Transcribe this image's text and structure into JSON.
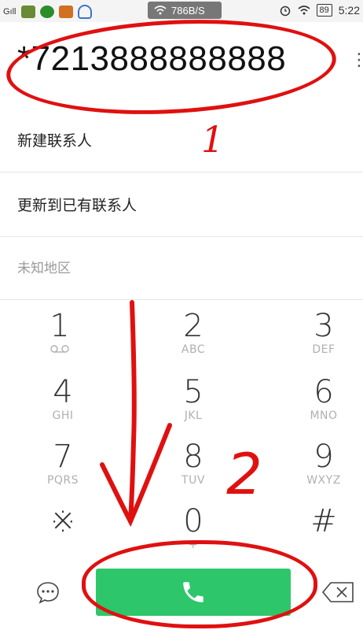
{
  "status_bar": {
    "signal": "Gıll",
    "network_speed": "786B/S",
    "battery": "89",
    "time": "5:22"
  },
  "dialer": {
    "number": "*7213888888888",
    "suggestions": [
      {
        "label": "新建联系人"
      },
      {
        "label": "更新到已有联系人"
      },
      {
        "label": "未知地区"
      }
    ],
    "keys": [
      {
        "digit": "1",
        "letters": ""
      },
      {
        "digit": "2",
        "letters": "ABC"
      },
      {
        "digit": "3",
        "letters": "DEF"
      },
      {
        "digit": "4",
        "letters": "GHI"
      },
      {
        "digit": "5",
        "letters": "JKL"
      },
      {
        "digit": "6",
        "letters": "MNO"
      },
      {
        "digit": "7",
        "letters": "PQRS"
      },
      {
        "digit": "8",
        "letters": "TUV"
      },
      {
        "digit": "9",
        "letters": "WXYZ"
      },
      {
        "digit": "※",
        "letters": ""
      },
      {
        "digit": "0",
        "letters": "+"
      },
      {
        "digit": "#",
        "letters": ""
      }
    ]
  },
  "annotations": {
    "mark1": "1",
    "mark2": "2"
  },
  "icons": {
    "sms": "message-icon",
    "call": "phone-icon",
    "backspace": "backspace-icon",
    "menu": "more-vert-icon"
  },
  "colors": {
    "call_button": "#2ec66b",
    "annotation": "#e01010"
  }
}
